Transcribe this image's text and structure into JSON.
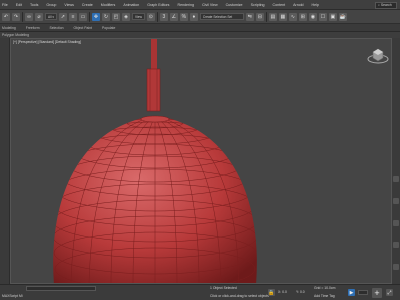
{
  "menu": {
    "items": [
      "File",
      "Edit",
      "Tools",
      "Group",
      "Views",
      "Create",
      "Modifiers",
      "Animation",
      "Graph Editors",
      "Rendering",
      "Civil View",
      "Customize",
      "Scripting",
      "Content",
      "Arnold",
      "Help"
    ],
    "search_label": "Search"
  },
  "toolbar": {
    "selection_set_label": "Create Selection Set",
    "view_dropdown": "View"
  },
  "ribbon": {
    "tabs": [
      "Modeling",
      "Freeform",
      "Selection",
      "Object Paint",
      "Populate"
    ],
    "sub": [
      "Polygon Modeling"
    ]
  },
  "viewport": {
    "label": "[+] [Perspective] [Standard] [Default Shading]"
  },
  "status": {
    "selected": "1 Object Selected",
    "prompt": "Click or click-and-drag to select objects",
    "maxscript": "MAXScript Mi",
    "coords": {
      "x": "X: 0.0",
      "y": "Y: 0.0",
      "z": "Z: 0.0"
    },
    "grid": "Grid = 10.0cm",
    "add_time_tag": "Add Time Tag",
    "autokey": "Auto Key",
    "selected_dropdown": "Selected",
    "set_key": "Set Key",
    "key_filters": "Key Filters...",
    "frame": "0"
  },
  "colors": {
    "object": "#b83a3a",
    "wire": "#7a1e1e",
    "accent": "#2f6fb3"
  },
  "icons": [
    "undo-icon",
    "redo-icon",
    "link-icon",
    "unlink-icon",
    "select-icon",
    "select-region-icon",
    "move-icon",
    "rotate-icon",
    "scale-icon",
    "snap-icon",
    "mirror-icon",
    "align-icon",
    "render-icon"
  ]
}
